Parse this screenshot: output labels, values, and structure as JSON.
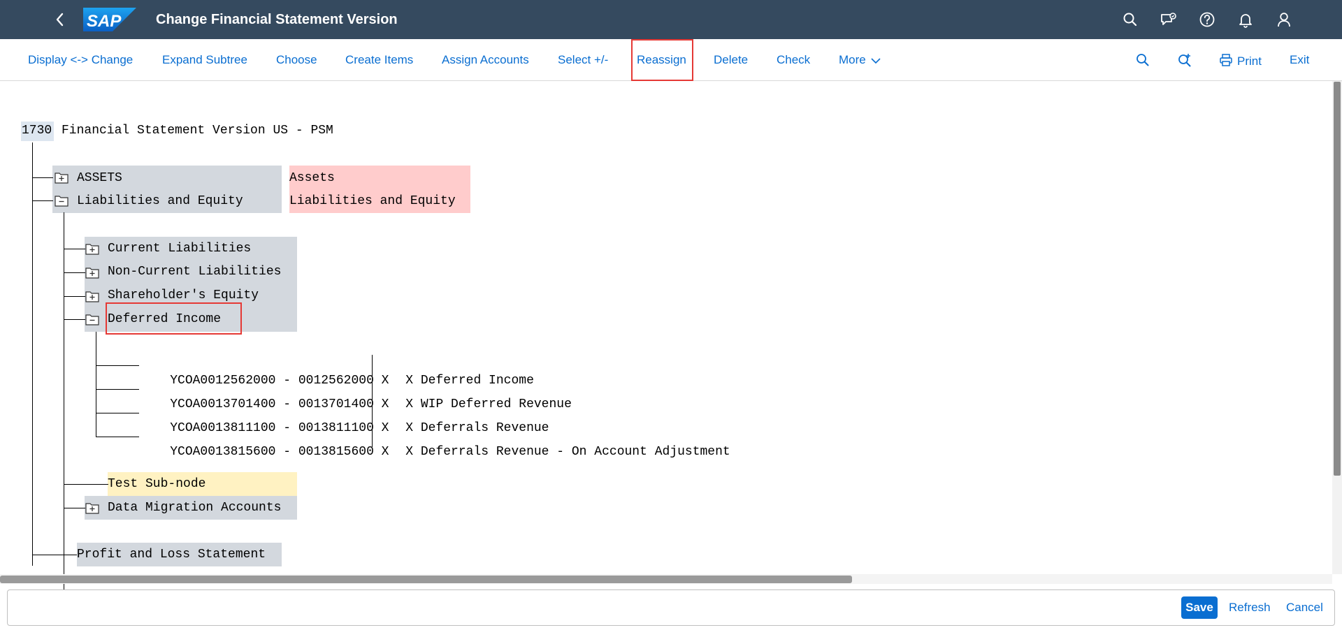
{
  "shell": {
    "title": "Change Financial Statement Version",
    "logo_text": "SAP",
    "icons": [
      "back-icon",
      "search-icon",
      "feedback-icon",
      "help-icon",
      "notifications-icon",
      "user-icon"
    ],
    "color": "#354a5f"
  },
  "toolbar": {
    "display_change": "Display <-> Change",
    "expand_subtree": "Expand Subtree",
    "choose": "Choose",
    "create_items": "Create Items",
    "assign_accounts": "Assign Accounts",
    "select_pm": "Select +/-",
    "reassign": "Reassign",
    "delete": "Delete",
    "check": "Check",
    "more": "More",
    "print": "Print",
    "exit": "Exit",
    "highlighted": "Reassign"
  },
  "tree": {
    "root_code": "1730",
    "root_name": "Financial Statement Version US - PSM",
    "level1": [
      {
        "label": "ASSETS",
        "text": "Assets",
        "state": "collapsed"
      },
      {
        "label": "Liabilities and Equity",
        "text": "Liabilities and Equity",
        "state": "expanded"
      }
    ],
    "level2": [
      {
        "label": "Current Liabilities",
        "state": "collapsed"
      },
      {
        "label": "Non-Current Liabilities",
        "state": "collapsed"
      },
      {
        "label": "Shareholder's Equity",
        "state": "collapsed"
      },
      {
        "label": "Deferred Income",
        "state": "expanded",
        "highlighted": true
      }
    ],
    "accounts": [
      {
        "text": "YCOA0012562000 - 0012562000 X",
        "sep": "X",
        "desc": "Deferred Income"
      },
      {
        "text": "YCOA0013701400 - 0013701400 X",
        "sep": "X",
        "desc": "WIP Deferred Revenue"
      },
      {
        "text": "YCOA0013811100 - 0013811100 X",
        "sep": "X",
        "desc": "Deferrals Revenue"
      },
      {
        "text": "YCOA0013815600 - 0013815600 X",
        "sep": "X",
        "desc": "Deferrals Revenue - On Account Adjustment"
      }
    ],
    "level2_after": [
      {
        "label": "Test Sub-node",
        "state": "leaf"
      },
      {
        "label": "Data Migration Accounts",
        "state": "collapsed"
      }
    ],
    "level1_after": {
      "label": "Profit and Loss Statement"
    }
  },
  "footer": {
    "save": "Save",
    "refresh": "Refresh",
    "cancel": "Cancel"
  },
  "colors": {
    "accent": "#0a6ed1",
    "node_bg": "#d3d8de",
    "text_bg": "#ffcccc",
    "new_node_bg": "#fff2c2",
    "root_bg": "#dde6f0",
    "highlight": "#e53935"
  }
}
